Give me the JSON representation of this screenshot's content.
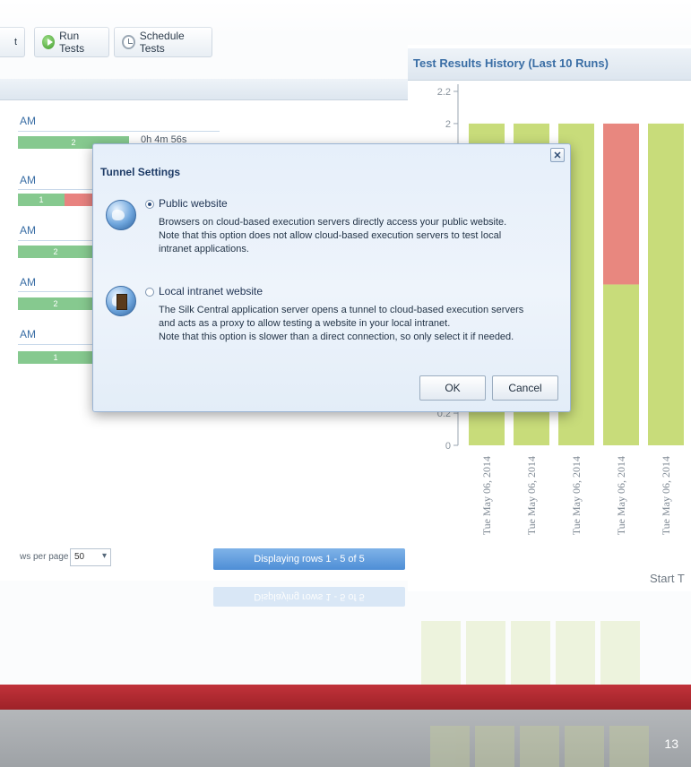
{
  "toolbar": {
    "partial_label": "t",
    "run_tests_label": "Run Tests",
    "schedule_tests_label": "Schedule Tests",
    "run_icon": "play-icon",
    "schedule_icon": "clock-icon"
  },
  "runs": {
    "items": [
      {
        "time": "AM",
        "pass": "2",
        "fail": ""
      },
      {
        "time": "AM",
        "pass": "1",
        "fail": ""
      },
      {
        "time": "AM",
        "pass": "2",
        "fail": ""
      },
      {
        "time": "AM",
        "pass": "2",
        "fail": ""
      },
      {
        "time": "AM",
        "pass": "1",
        "fail": ""
      }
    ],
    "first_duration": "0h 4m 56s"
  },
  "pager": {
    "rows_label": "ws per page",
    "rows_value": "50",
    "info": "Displaying rows 1 - 5 of 5"
  },
  "chart_panel": {
    "title": "Test Results History (Last 10 Runs)",
    "x_axis_partial_label": "Start T"
  },
  "chart_data": {
    "type": "bar",
    "title": "Test Results History (Last 10 Runs)",
    "ylim": [
      0,
      2.2
    ],
    "y_ticks": [
      "0",
      "0.2",
      "2",
      "2.2"
    ],
    "categories": [
      "Tue May 06, 2014",
      "Tue May 06, 2014",
      "Tue May 06, 2014",
      "Tue May 06, 2014",
      "Tue May 06, 2014"
    ],
    "series": [
      {
        "name": "",
        "color": "#c8dc7a",
        "values": [
          2,
          2,
          2,
          1,
          2
        ]
      },
      {
        "name": "",
        "color": "#e8877f",
        "values": [
          0,
          0,
          0,
          1,
          0
        ]
      }
    ],
    "xlabel": "Start T"
  },
  "dialog": {
    "title": "Tunnel Settings",
    "close_label": "✕",
    "public": {
      "label": "Public website",
      "desc": [
        "Browsers on cloud-based execution servers directly access your public website.",
        "Note that this option does not allow cloud-based execution servers to test local",
        "intranet applications."
      ]
    },
    "intranet": {
      "label": "Local intranet website",
      "desc": [
        "The Silk Central application server opens a tunnel to cloud-based execution servers",
        "and acts as a proxy to allow testing a website in your local intranet.",
        "Note that this option is slower than a direct connection, so only select it if needed."
      ]
    },
    "ok_label": "OK",
    "cancel_label": "Cancel"
  },
  "footer": {
    "slide_number": "13"
  },
  "colors": {
    "pass": "#86c98f",
    "fail": "#e8827f",
    "accent": "#3a6ea5",
    "footer_red": "#b02a30",
    "footer_gray": "#a8abaf"
  }
}
